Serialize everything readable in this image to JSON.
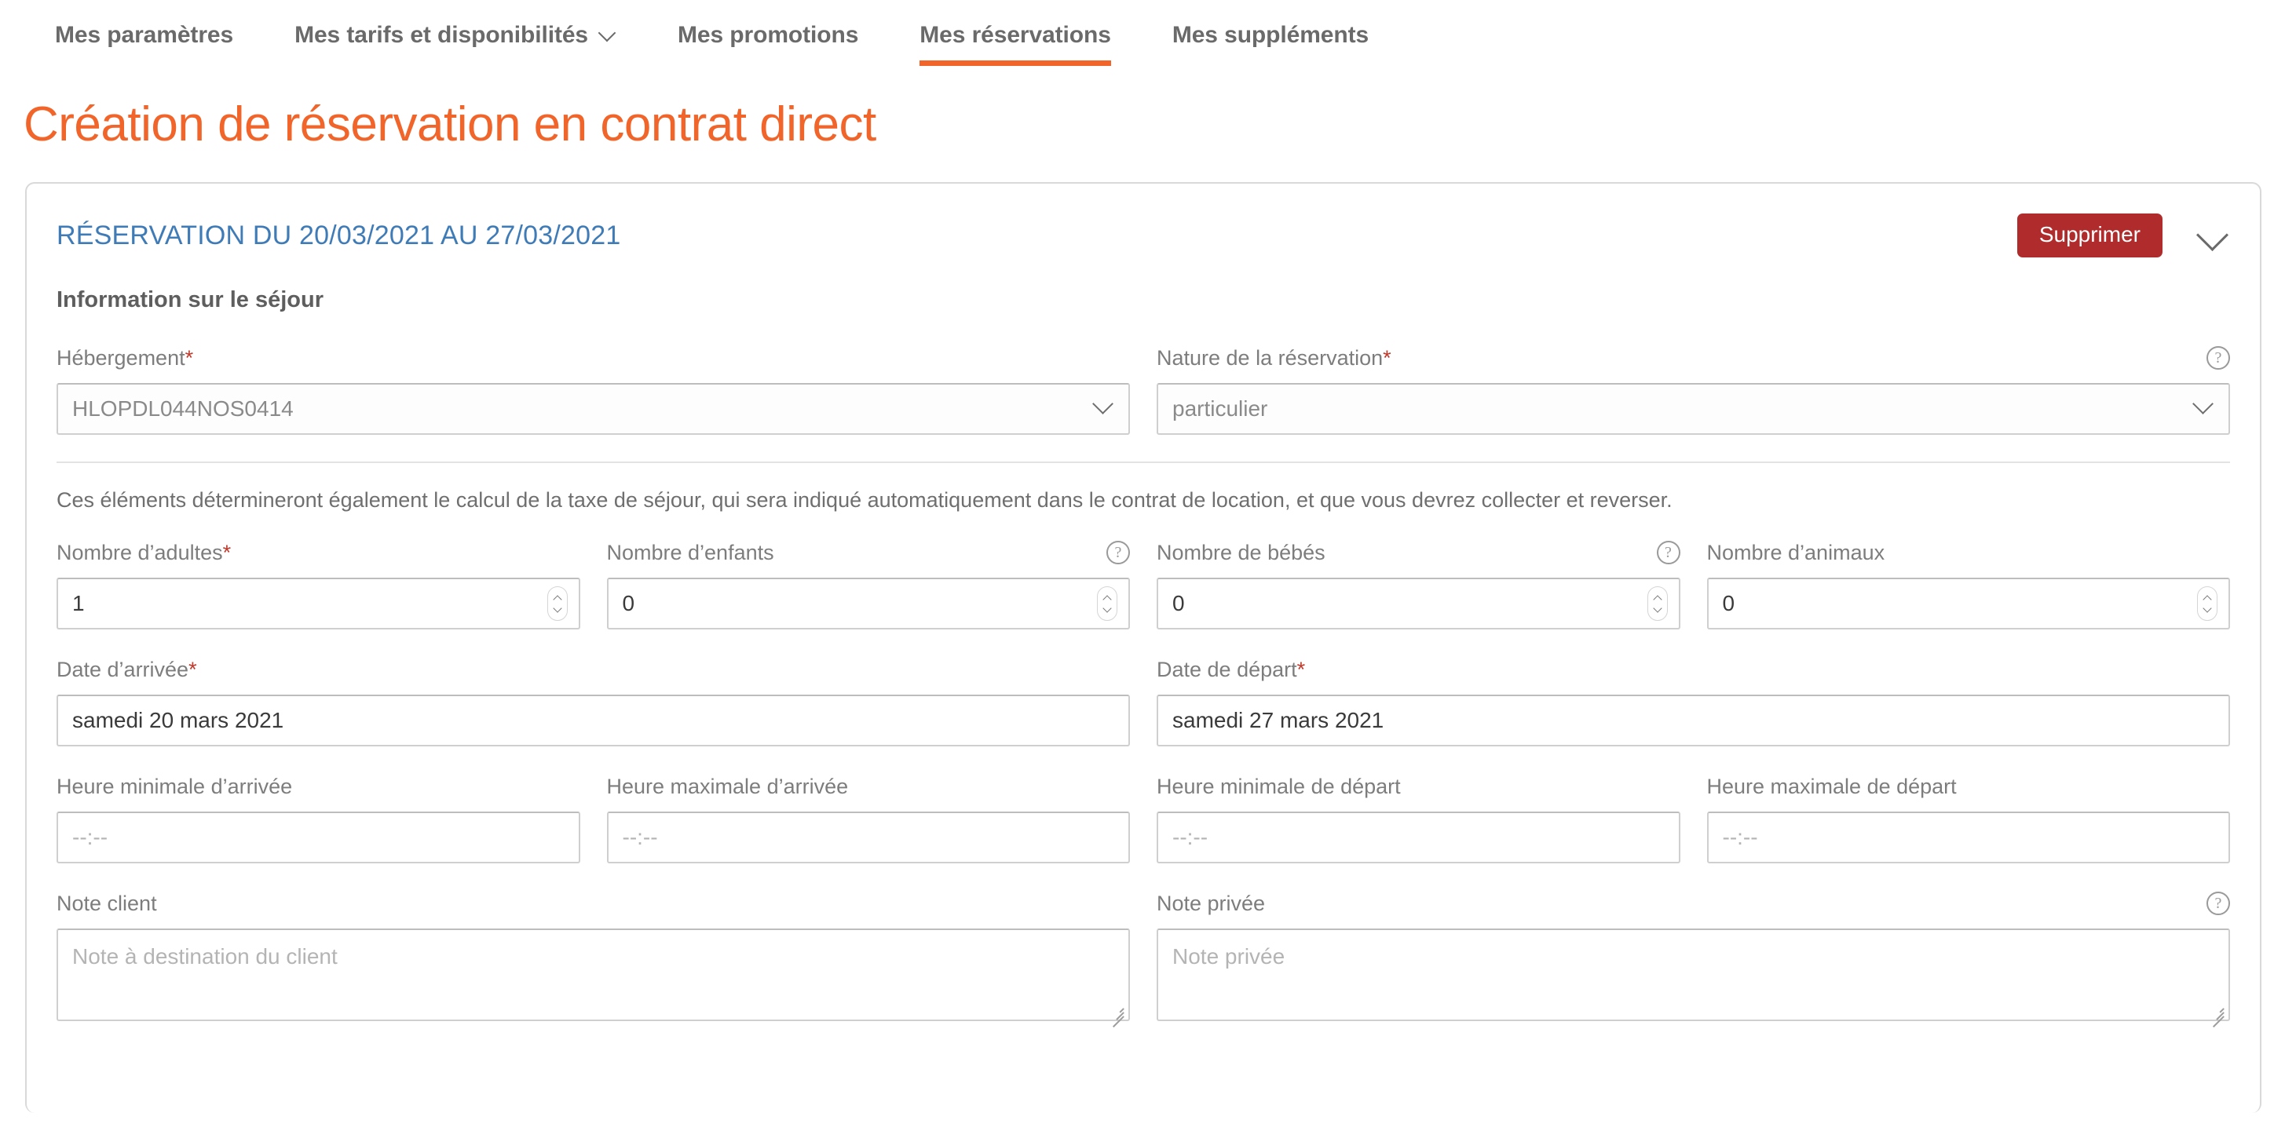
{
  "nav": {
    "items": [
      {
        "label": "Mes paramètres",
        "has_caret": false,
        "active": false
      },
      {
        "label": "Mes tarifs et disponibilités",
        "has_caret": true,
        "active": false
      },
      {
        "label": "Mes promotions",
        "has_caret": false,
        "active": false
      },
      {
        "label": "Mes réservations",
        "has_caret": false,
        "active": true
      },
      {
        "label": "Mes suppléments",
        "has_caret": false,
        "active": false
      }
    ]
  },
  "page": {
    "title": "Création de réservation en contrat direct",
    "accent_color": "#f1642a"
  },
  "card": {
    "title": "RÉSERVATION DU 20/03/2021 AU 27/03/2021",
    "title_color": "#3f7bb6",
    "delete_label": "Supprimer",
    "delete_color": "#b02b2b",
    "collapse_icon": "chevron-down-icon",
    "section_title": "Information sur le séjour",
    "helper_text": "Ces éléments détermineront également le calcul de la taxe de séjour, qui sera indiqué automatiquement dans le contrat de location, et que vous devrez collecter et reverser."
  },
  "fields": {
    "hebergement": {
      "label": "Hébergement",
      "required": "*",
      "value": "HLOPDL044NOS0414",
      "help": false
    },
    "nature": {
      "label": "Nature de la réservation",
      "required": "*",
      "value": "particulier",
      "help": true,
      "help_icon": "help-circle-icon"
    },
    "adultes": {
      "label": "Nombre d’adultes",
      "required": "*",
      "value": "1",
      "help": false
    },
    "enfants": {
      "label": "Nombre d’enfants",
      "required": "",
      "value": "0",
      "help": true,
      "help_icon": "help-circle-icon"
    },
    "bebes": {
      "label": "Nombre de bébés",
      "required": "",
      "value": "0",
      "help": true,
      "help_icon": "help-circle-icon"
    },
    "animaux": {
      "label": "Nombre d’animaux",
      "required": "",
      "value": "0",
      "help": false
    },
    "date_arrivee": {
      "label": "Date d’arrivée",
      "required": "*",
      "value": "samedi 20 mars 2021",
      "help": false
    },
    "date_depart": {
      "label": "Date de départ",
      "required": "*",
      "value": "samedi 27 mars 2021",
      "help": false
    },
    "heure_min_arrivee": {
      "label": "Heure minimale d’arrivée",
      "required": "",
      "value": "",
      "placeholder": "--:--",
      "help": false
    },
    "heure_max_arrivee": {
      "label": "Heure maximale d’arrivée",
      "required": "",
      "value": "",
      "placeholder": "--:--",
      "help": false
    },
    "heure_min_depart": {
      "label": "Heure minimale de départ",
      "required": "",
      "value": "",
      "placeholder": "--:--",
      "help": false
    },
    "heure_max_depart": {
      "label": "Heure maximale de départ",
      "required": "",
      "value": "",
      "placeholder": "--:--",
      "help": false
    },
    "note_client": {
      "label": "Note client",
      "required": "",
      "value": "",
      "placeholder": "Note à destination du client",
      "help": false
    },
    "note_privee": {
      "label": "Note privée",
      "required": "",
      "value": "",
      "placeholder": "Note privée",
      "help": true,
      "help_icon": "help-circle-icon"
    }
  }
}
